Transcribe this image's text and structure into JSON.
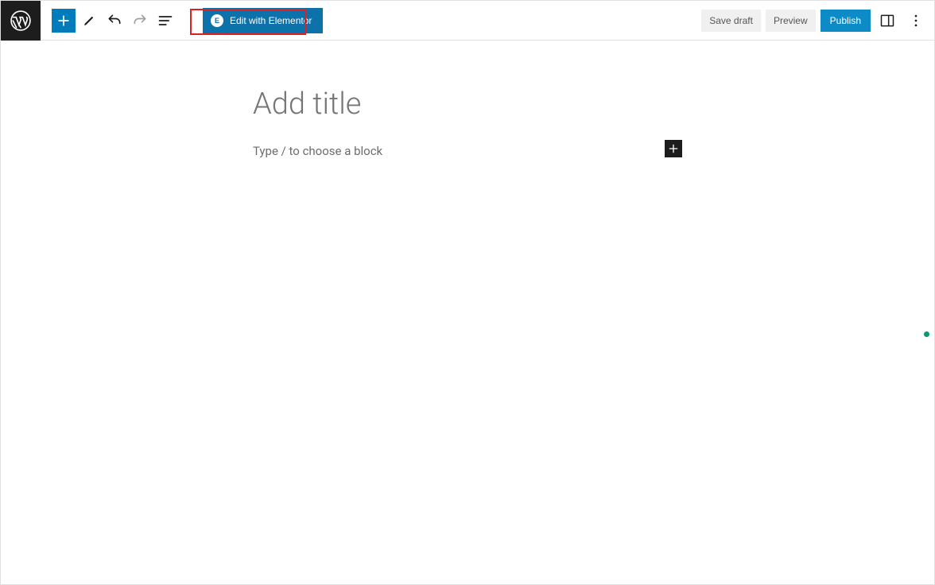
{
  "toolbar": {
    "elementor_label": "Edit with Elementor",
    "save_draft_label": "Save draft",
    "preview_label": "Preview",
    "publish_label": "Publish"
  },
  "editor": {
    "title_placeholder": "Add title",
    "block_placeholder": "Type / to choose a block"
  },
  "icons": {
    "elementor_letter": "E"
  }
}
